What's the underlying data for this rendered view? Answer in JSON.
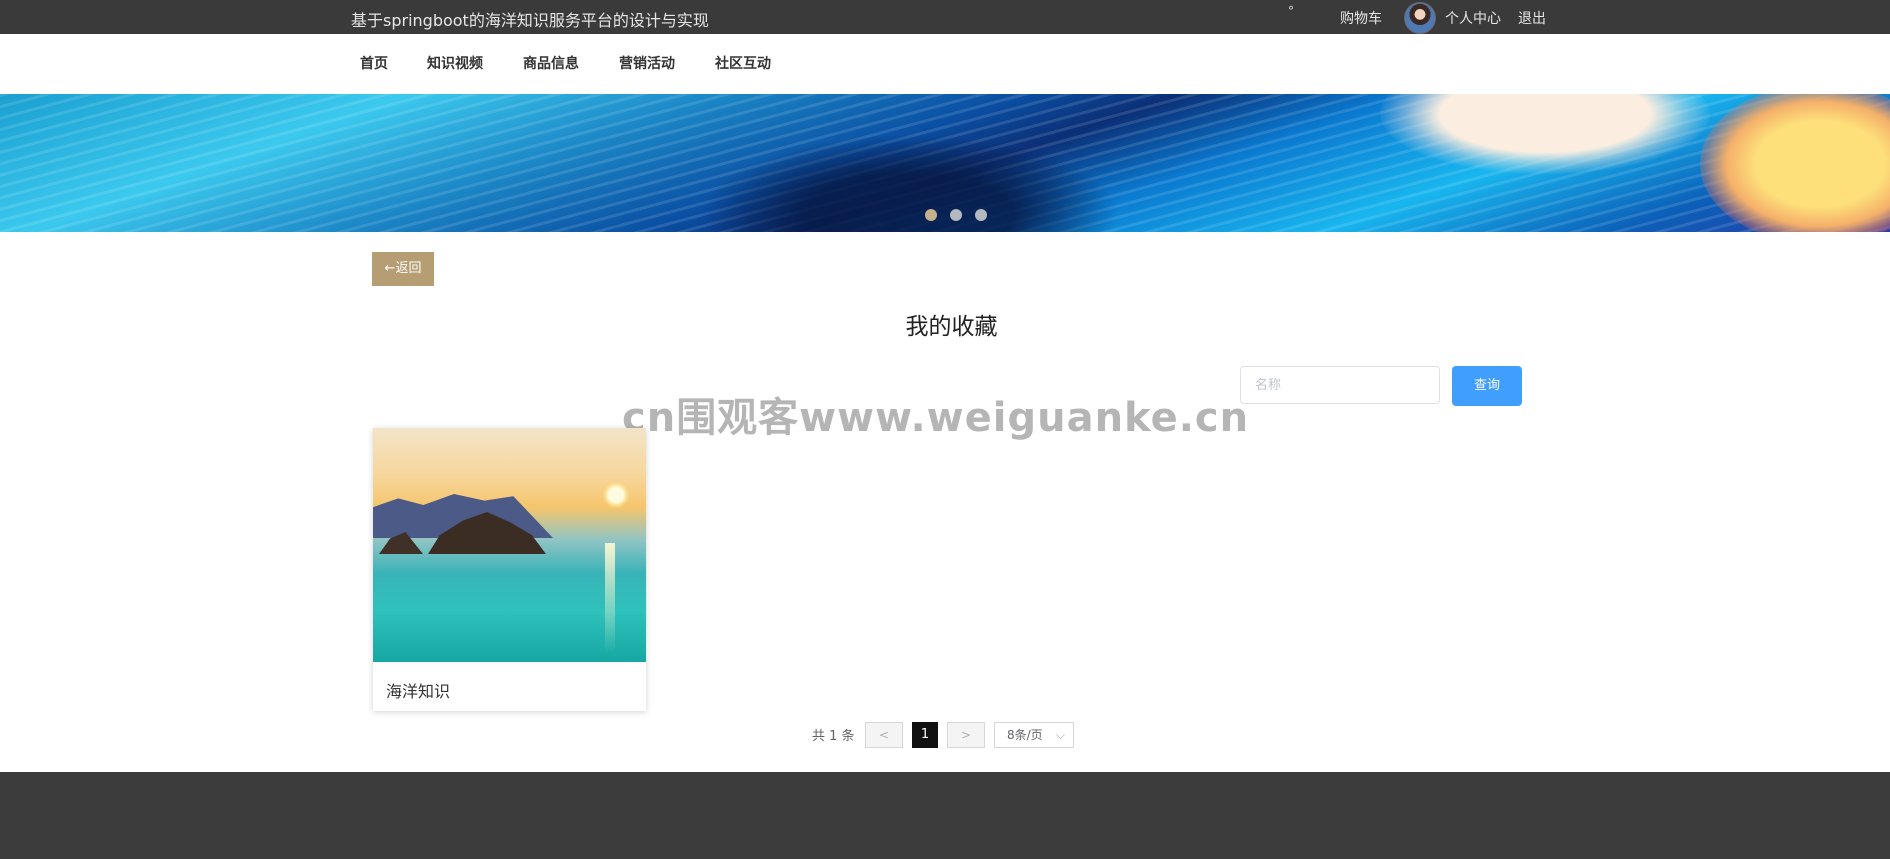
{
  "topbar": {
    "site_title": "基于springboot的海洋知识服务平台的设计与实现",
    "mark": "°",
    "cart_label": "购物车",
    "profile_label": "个人中心",
    "logout_label": "退出"
  },
  "nav": {
    "items": [
      {
        "label": "首页"
      },
      {
        "label": "知识视频"
      },
      {
        "label": "商品信息"
      },
      {
        "label": "营销活动"
      },
      {
        "label": "社区互动"
      }
    ]
  },
  "banner": {
    "slide_count": 3,
    "active_slide": 1
  },
  "main": {
    "back_label": "←返回",
    "page_title": "我的收藏",
    "search_placeholder": "名称",
    "search_button": "查询",
    "watermark": "cn围观客www.weiguanke.cn"
  },
  "favorites": [
    {
      "title": "海洋知识"
    }
  ],
  "pagination": {
    "total_text": "共 1 条",
    "prev": "<",
    "current_page": "1",
    "next": ">",
    "page_size": "8条/页",
    "chevron": "⌵"
  },
  "colors": {
    "topbar_bg": "#3a3a3a",
    "back_button": "#b69d73",
    "search_button": "#409eff",
    "active_page": "#111111",
    "footer_bg": "#3c3c3c"
  }
}
